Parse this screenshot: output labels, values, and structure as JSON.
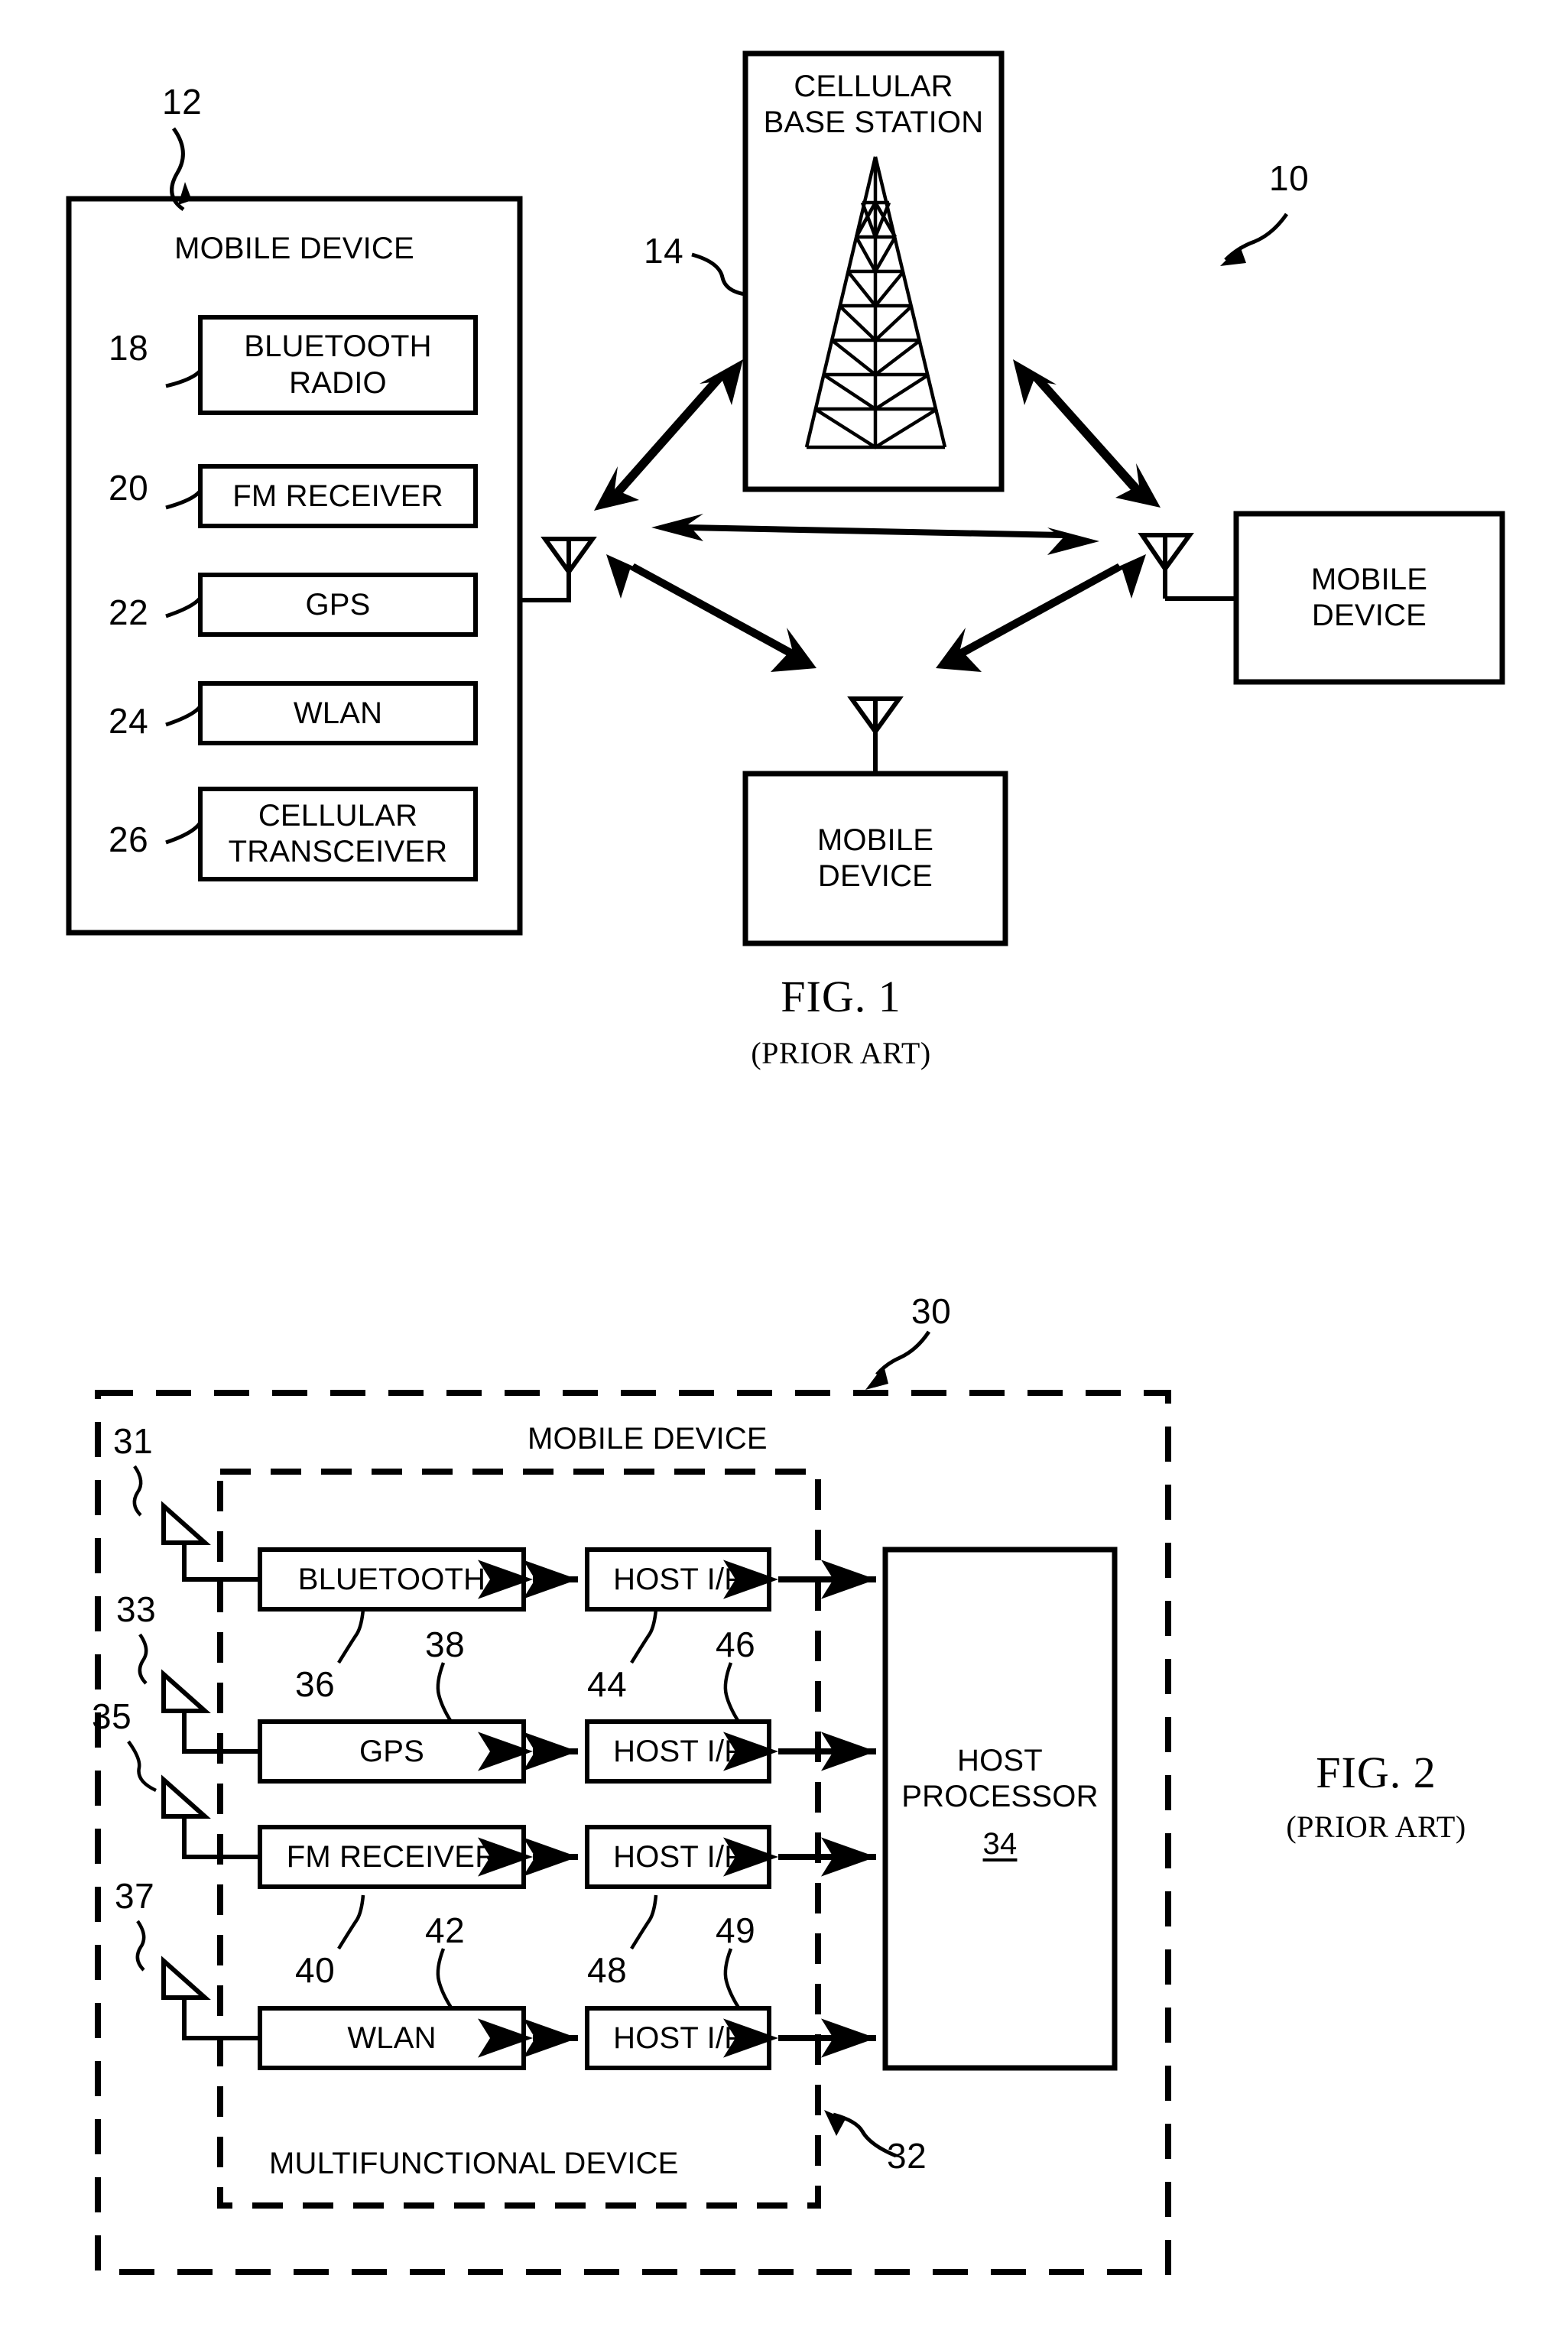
{
  "document": {
    "type": "patent-drawing-sheet",
    "figures": [
      "FIG. 1",
      "FIG. 2"
    ]
  },
  "fig1": {
    "caption": "FIG. 1",
    "subcaption": "(PRIOR ART)",
    "system_ref": "10",
    "mobile_device": {
      "ref": "12",
      "title": "MOBILE DEVICE",
      "blocks": [
        {
          "ref": "18",
          "label": "BLUETOOTH RADIO",
          "line1": "BLUETOOTH",
          "line2": "RADIO"
        },
        {
          "ref": "20",
          "label": "FM RECEIVER",
          "line1": "FM RECEIVER",
          "line2": ""
        },
        {
          "ref": "22",
          "label": "GPS",
          "line1": "GPS",
          "line2": ""
        },
        {
          "ref": "24",
          "label": "WLAN",
          "line1": "WLAN",
          "line2": ""
        },
        {
          "ref": "26",
          "label": "CELLULAR TRANSCEIVER",
          "line1": "CELLULAR",
          "line2": "TRANSCEIVER"
        }
      ]
    },
    "base_station": {
      "ref": "14",
      "line1": "CELLULAR",
      "line2": "BASE STATION",
      "icon": "cell-tower-icon"
    },
    "peer_right": {
      "line1": "MOBILE",
      "line2": "DEVICE"
    },
    "peer_bottom": {
      "line1": "MOBILE",
      "line2": "DEVICE"
    },
    "links": [
      {
        "from": "mobile-device-antenna",
        "to": "base-station",
        "type": "double-arrow"
      },
      {
        "from": "base-station",
        "to": "peer-right-antenna",
        "type": "double-arrow"
      },
      {
        "from": "mobile-device-antenna",
        "to": "peer-right-antenna",
        "type": "double-arrow"
      },
      {
        "from": "mobile-device-antenna",
        "to": "peer-bottom-antenna",
        "type": "double-arrow"
      },
      {
        "from": "peer-right-antenna",
        "to": "peer-bottom-antenna",
        "type": "double-arrow"
      }
    ]
  },
  "fig2": {
    "caption": "FIG. 2",
    "subcaption": "(PRIOR ART)",
    "outer": {
      "ref": "30",
      "title": "MOBILE DEVICE"
    },
    "inner": {
      "ref": "32",
      "title": "MULTIFUNCTIONAL DEVICE"
    },
    "antennas": [
      {
        "ref": "31"
      },
      {
        "ref": "33"
      },
      {
        "ref": "35"
      },
      {
        "ref": "37"
      }
    ],
    "rows": [
      {
        "radio": "BLUETOOTH",
        "radio_ref": "36",
        "radio_ref2": "38",
        "hostif": "HOST I/F",
        "hostif_ref": "44",
        "hostif_ref2": "46"
      },
      {
        "radio": "GPS",
        "radio_ref": "",
        "radio_ref2": "",
        "hostif": "HOST I/F",
        "hostif_ref": "",
        "hostif_ref2": ""
      },
      {
        "radio": "FM RECEIVER",
        "radio_ref": "40",
        "radio_ref2": "42",
        "hostif": "HOST I/F",
        "hostif_ref": "48",
        "hostif_ref2": "49"
      },
      {
        "radio": "WLAN",
        "radio_ref": "",
        "radio_ref2": "",
        "hostif": "HOST I/F",
        "hostif_ref": "",
        "hostif_ref2": ""
      }
    ],
    "host_processor": {
      "line1": "HOST",
      "line2": "PROCESSOR",
      "ref": "34"
    }
  },
  "colors": {
    "ink": "#000000",
    "paper": "#ffffff"
  }
}
